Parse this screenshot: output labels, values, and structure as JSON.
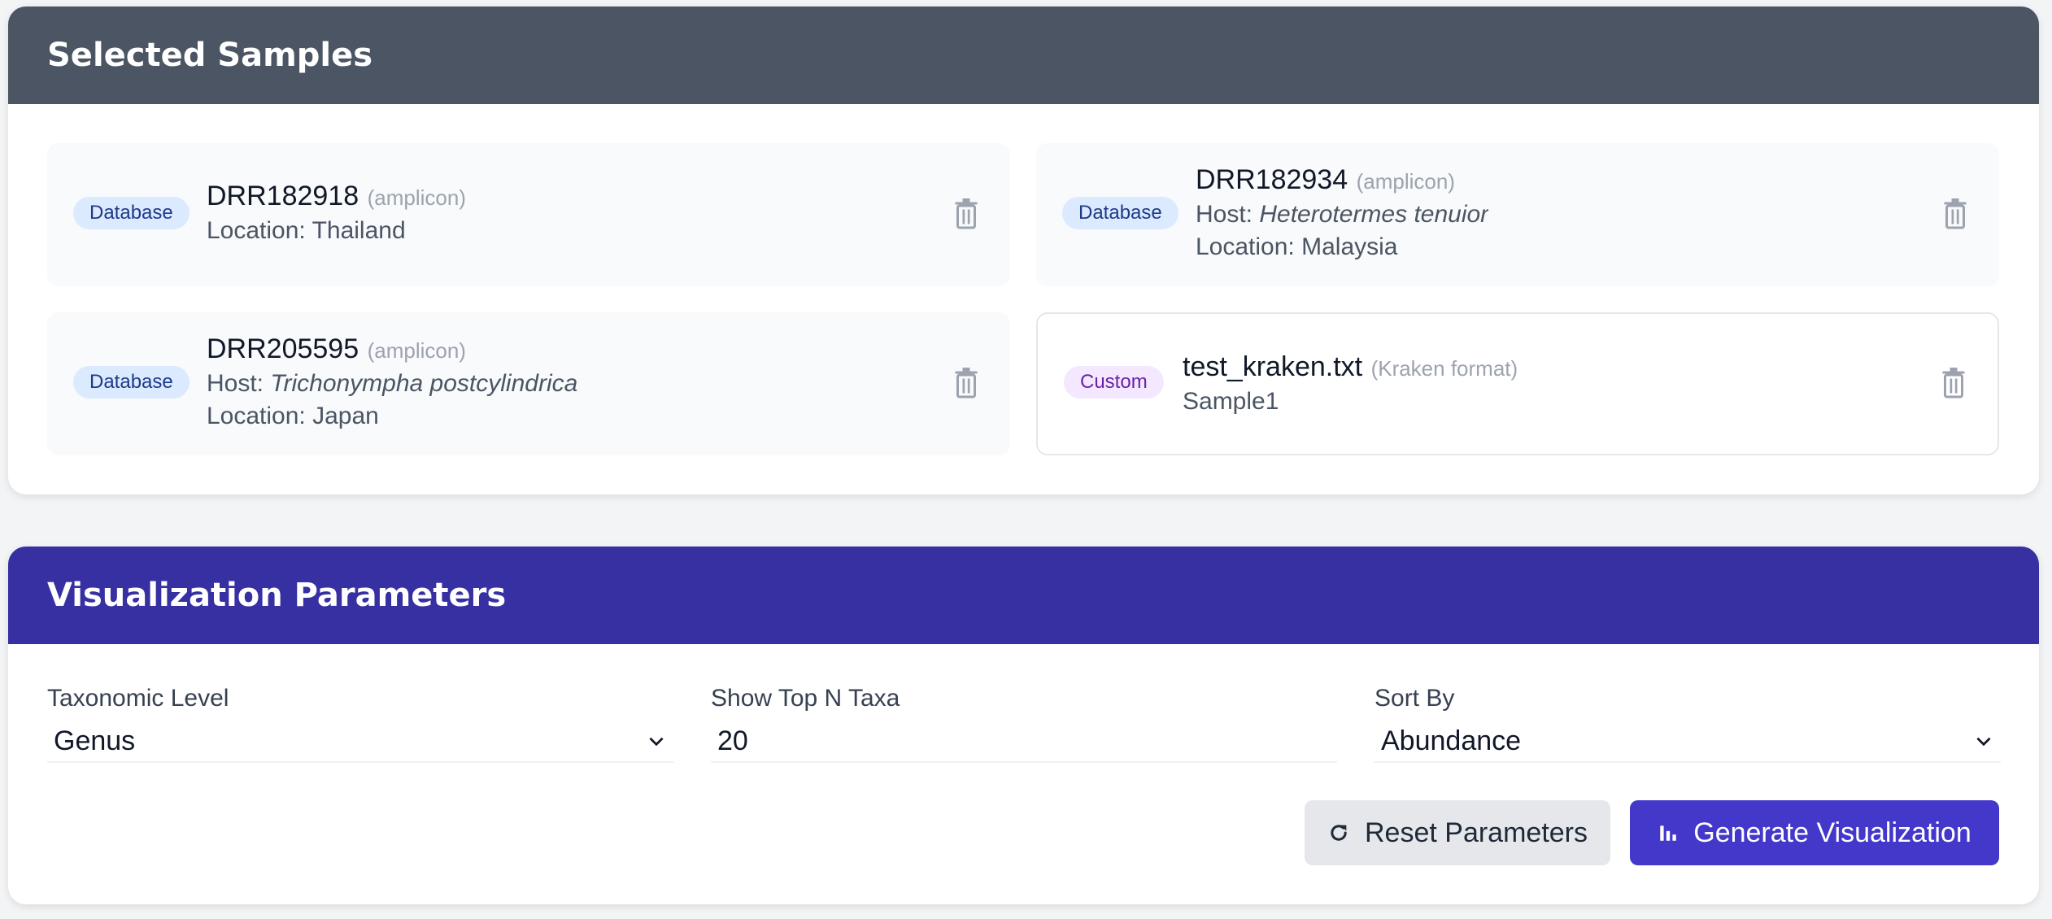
{
  "selected_samples": {
    "title": "Selected Samples",
    "cards": [
      {
        "badge": "Database",
        "id": "DRR182918",
        "type": "(amplicon)",
        "location_label": "Location:",
        "location": "Thailand"
      },
      {
        "badge": "Database",
        "id": "DRR182934",
        "type": "(amplicon)",
        "host_label": "Host:",
        "host": "Heterotermes tenuior",
        "location_label": "Location:",
        "location": "Malaysia"
      },
      {
        "badge": "Database",
        "id": "DRR205595",
        "type": "(amplicon)",
        "host_label": "Host:",
        "host": "Trichonympha postcylindrica",
        "location_label": "Location:",
        "location": "Japan"
      },
      {
        "badge": "Custom",
        "id": "test_kraken.txt",
        "type": "(Kraken format)",
        "sample": "Sample1"
      }
    ],
    "delete_icon": "trash-icon"
  },
  "visualization_parameters": {
    "title": "Visualization Parameters",
    "taxonomic_level": {
      "label": "Taxonomic Level",
      "value": "Genus"
    },
    "top_n": {
      "label": "Show Top N Taxa",
      "value": "20"
    },
    "sort_by": {
      "label": "Sort By",
      "value": "Abundance"
    },
    "reset_button": {
      "label": "Reset Parameters",
      "icon": "refresh-icon"
    },
    "generate_button": {
      "label": "Generate Visualization",
      "icon": "bar-chart-icon"
    }
  },
  "colors": {
    "samples_header": "#4b5563",
    "params_header": "#3730a3",
    "generate_button": "#4338ca",
    "database_badge_bg": "#dbeafe",
    "custom_badge_bg": "#f3e8ff"
  }
}
